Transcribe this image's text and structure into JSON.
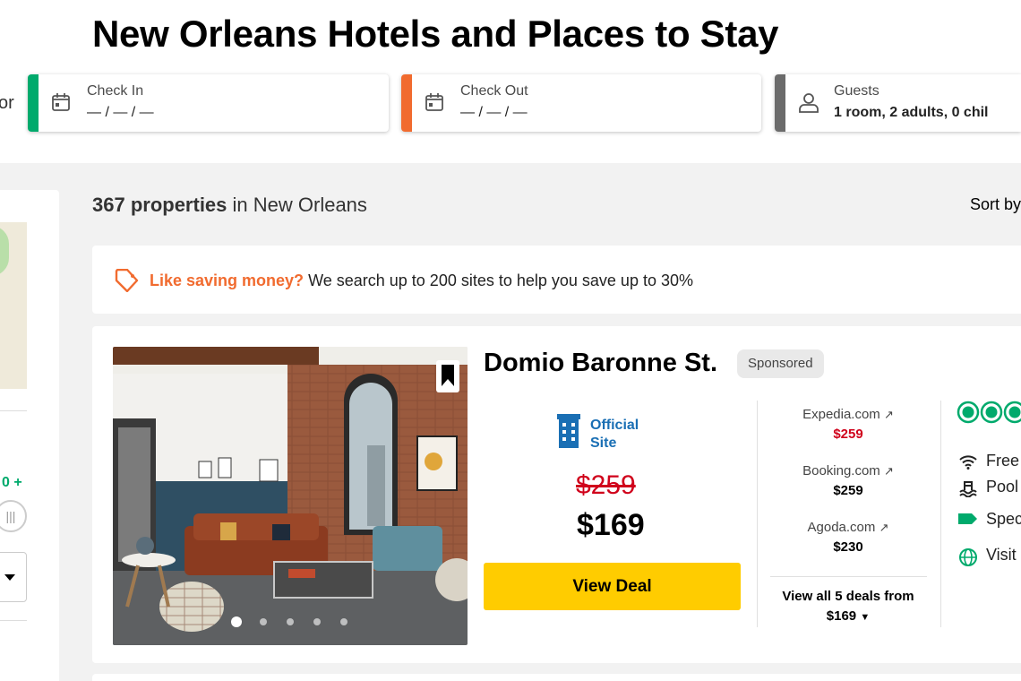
{
  "header": {
    "title": "New Orleans Hotels and Places to Stay",
    "partial_label": "or"
  },
  "search": {
    "check_in": {
      "label": "Check In",
      "value": "— / — / —"
    },
    "check_out": {
      "label": "Check Out",
      "value": "— / — / —"
    },
    "guests": {
      "label": "Guests",
      "value": "1 room, 2 adults, 0 chil"
    }
  },
  "sidebar": {
    "green_text": "0 +"
  },
  "results": {
    "count": "367 properties",
    "location_text": " in New Orleans",
    "sort_label": "Sort by"
  },
  "promo": {
    "highlight": "Like saving money?",
    "text": " We search up to 200 sites to help you save up to 30%"
  },
  "listing": {
    "name": "Domio Baronne St.",
    "badge": "Sponsored",
    "official_site_line1": "Official",
    "official_site_line2": "Site",
    "original_price": "$259",
    "price": "$169",
    "view_deal_label": "View Deal",
    "deals": [
      {
        "site": "Expedia.com",
        "price": "$259",
        "highlighted": true
      },
      {
        "site": "Booking.com",
        "price": "$259",
        "highlighted": false
      },
      {
        "site": "Agoda.com",
        "price": "$230",
        "highlighted": false
      }
    ],
    "view_all_line1": "View all 5 deals from",
    "view_all_line2": "$169",
    "amenities": [
      "Free",
      "Pool",
      "Spec",
      "Visit"
    ],
    "photo_dots": 5,
    "active_dot": 0
  },
  "colors": {
    "checkin_stripe": "#00aa6c",
    "checkout_stripe": "#f16b2f",
    "guests_stripe": "#6b6b6b",
    "promo_highlight": "#f16b2f",
    "sale_red": "#d0021b",
    "deal_button": "#ffcc00",
    "official_blue": "#1a6fb4",
    "rating_green": "#00aa6c"
  }
}
